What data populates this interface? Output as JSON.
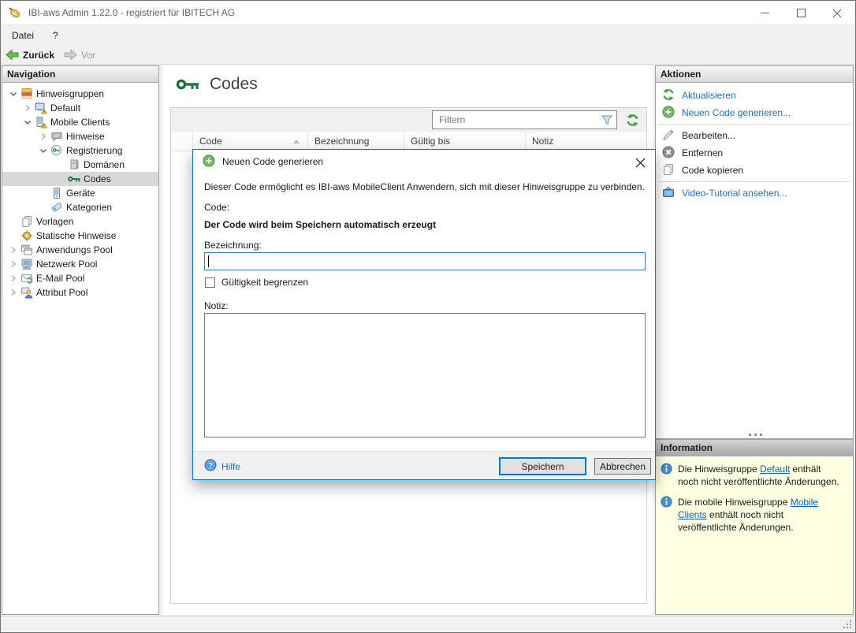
{
  "titlebar": {
    "title": "IBI-aws Admin 1.22.0 - registriert für IBITECH AG"
  },
  "menubar": {
    "items": [
      {
        "label": "Datei"
      },
      {
        "label": "?"
      }
    ]
  },
  "toolbar": {
    "back_label": "Zurück",
    "forward_label": "Vor"
  },
  "navigation": {
    "header": "Navigation",
    "items": [
      {
        "label": "Hinweisgruppen",
        "level": 0,
        "state": "expanded",
        "icon": "notice-groups"
      },
      {
        "label": "Default",
        "level": 1,
        "state": "collapsed",
        "icon": "monitor-warning"
      },
      {
        "label": "Mobile Clients",
        "level": 1,
        "state": "expanded",
        "icon": "phone-warning"
      },
      {
        "label": "Hinweise",
        "level": 2,
        "state": "collapsed",
        "icon": "speech-bubble"
      },
      {
        "label": "Registrierung",
        "level": 2,
        "state": "expanded",
        "icon": "registration"
      },
      {
        "label": "Domänen",
        "level": 3,
        "state": "none",
        "icon": "server"
      },
      {
        "label": "Codes",
        "level": 3,
        "state": "none",
        "icon": "key",
        "selected": true
      },
      {
        "label": "Geräte",
        "level": 2,
        "state": "none",
        "icon": "mobile-device"
      },
      {
        "label": "Kategorien",
        "level": 2,
        "state": "none",
        "icon": "tag"
      },
      {
        "label": "Vorlagen",
        "level": 0,
        "state": "none",
        "icon": "documents"
      },
      {
        "label": "Statische Hinweise",
        "level": 0,
        "state": "none",
        "icon": "gear"
      },
      {
        "label": "Anwendungs Pool",
        "level": 0,
        "state": "collapsed",
        "icon": "app-windows"
      },
      {
        "label": "Netzwerk Pool",
        "level": 0,
        "state": "collapsed",
        "icon": "network-computer"
      },
      {
        "label": "E-Mail Pool",
        "level": 0,
        "state": "collapsed",
        "icon": "email"
      },
      {
        "label": "Attribut Pool",
        "level": 0,
        "state": "collapsed",
        "icon": "user"
      }
    ]
  },
  "main": {
    "title": "Codes",
    "filter_placeholder": "Filtern",
    "columns": [
      {
        "label": "Code",
        "sorted": "asc"
      },
      {
        "label": "Bezeichnung"
      },
      {
        "label": "Gültig bis"
      },
      {
        "label": "Notiz"
      }
    ]
  },
  "actions": {
    "header": "Aktionen",
    "items": [
      {
        "label": "Aktualisieren",
        "icon": "refresh",
        "style": "link"
      },
      {
        "label": "Neuen Code generieren...",
        "icon": "add-circle",
        "style": "link"
      },
      {
        "label": "Bearbeiten...",
        "icon": "pencil",
        "style": "plain"
      },
      {
        "label": "Entfernen",
        "icon": "remove-circle",
        "style": "plain"
      },
      {
        "label": "Code kopieren",
        "icon": "copy",
        "style": "plain"
      },
      {
        "label": "Video-Tutorial ansehen...",
        "icon": "video",
        "style": "link"
      }
    ]
  },
  "information": {
    "header": "Information",
    "items": [
      {
        "prefix": "Die Hinweisgruppe ",
        "link": "Default",
        "suffix": " enthält noch nicht veröffentlichte Änderungen."
      },
      {
        "prefix": "Die mobile Hinweisgruppe ",
        "link": "Mobile Clients",
        "suffix": " enthält noch nicht veröffentlichte Änderungen."
      }
    ]
  },
  "dialog": {
    "title": "Neuen Code generieren",
    "description": "Dieser Code ermöglicht es IBI-aws MobileClient Anwendern, sich mit dieser Hinweisgruppe zu verbinden.",
    "code_label": "Code:",
    "code_hint": "Der Code wird beim Speichern automatisch erzeugt",
    "name_label": "Bezeichnung:",
    "name_value": "",
    "validity_checkbox_label": "Gültigkeit begrenzen",
    "validity_checked": false,
    "note_label": "Notiz:",
    "note_value": "",
    "help_label": "Hilfe",
    "save_label": "Speichern",
    "cancel_label": "Abbrechen"
  },
  "colors": {
    "accent": "#0078d4",
    "link_blue": "#1d6ec6",
    "icon_green": "#3fa23f",
    "key_green": "#1a7242",
    "info_panel_bg": "#ffffe1",
    "selected_row_bg": "#d8d8d8"
  }
}
